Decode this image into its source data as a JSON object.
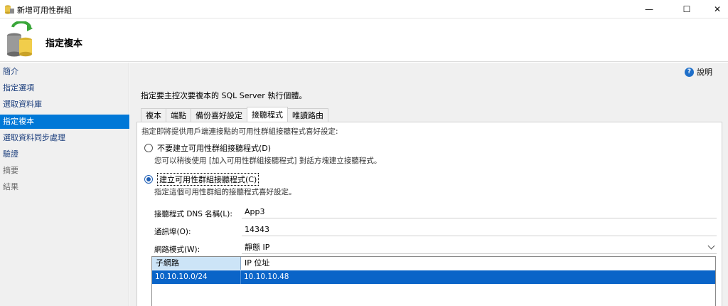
{
  "window": {
    "title": "新增可用性群組",
    "minimize": "—",
    "maximize": "☐",
    "close": "✕"
  },
  "header": {
    "title": "指定複本",
    "icon": "database-sync-icon"
  },
  "nav": {
    "items": [
      {
        "label": "簡介",
        "state": "normal"
      },
      {
        "label": "指定選項",
        "state": "normal"
      },
      {
        "label": "選取資料庫",
        "state": "normal"
      },
      {
        "label": "指定複本",
        "state": "active"
      },
      {
        "label": "選取資料同步處理",
        "state": "normal"
      },
      {
        "label": "驗證",
        "state": "normal"
      },
      {
        "label": "摘要",
        "state": "disabled"
      },
      {
        "label": "結果",
        "state": "disabled"
      }
    ]
  },
  "help": {
    "label": "說明",
    "icon": "help-icon"
  },
  "instruction": "指定要主控次要複本的 SQL Server 執行個體。",
  "tabs": [
    {
      "label": "複本",
      "active": false
    },
    {
      "label": "端點",
      "active": false
    },
    {
      "label": "備份喜好設定",
      "active": false
    },
    {
      "label": "接聽程式",
      "active": true
    },
    {
      "label": "唯讀路由",
      "active": false
    }
  ],
  "listener": {
    "description": "指定即將提供用戶端連接點的可用性群組接聽程式喜好設定:",
    "option_none": {
      "label": "不要建立可用性群組接聽程式(D)",
      "sub": "您可以稍後使用 [加入可用性群組接聽程式] 對話方塊建立接聽程式。",
      "checked": false
    },
    "option_create": {
      "label": "建立可用性群組接聽程式(C)",
      "sub": "指定這個可用性群組的接聽程式喜好設定。",
      "checked": true
    },
    "dns_label": "接聽程式 DNS 名稱(L):",
    "dns_value": "App3",
    "port_label": "通訊埠(O):",
    "port_value": "14343",
    "network_label": "網路模式(W):",
    "network_value": "靜態 IP"
  },
  "ip_grid": {
    "columns": [
      "子網路",
      "IP 位址"
    ],
    "rows": [
      {
        "subnet": "10.10.10.0/24",
        "ip": "10.10.10.48"
      }
    ]
  },
  "colors": {
    "accent": "#0078d7",
    "selected_row": "#0a64c8",
    "nav_bg": "#f0f0f0"
  }
}
